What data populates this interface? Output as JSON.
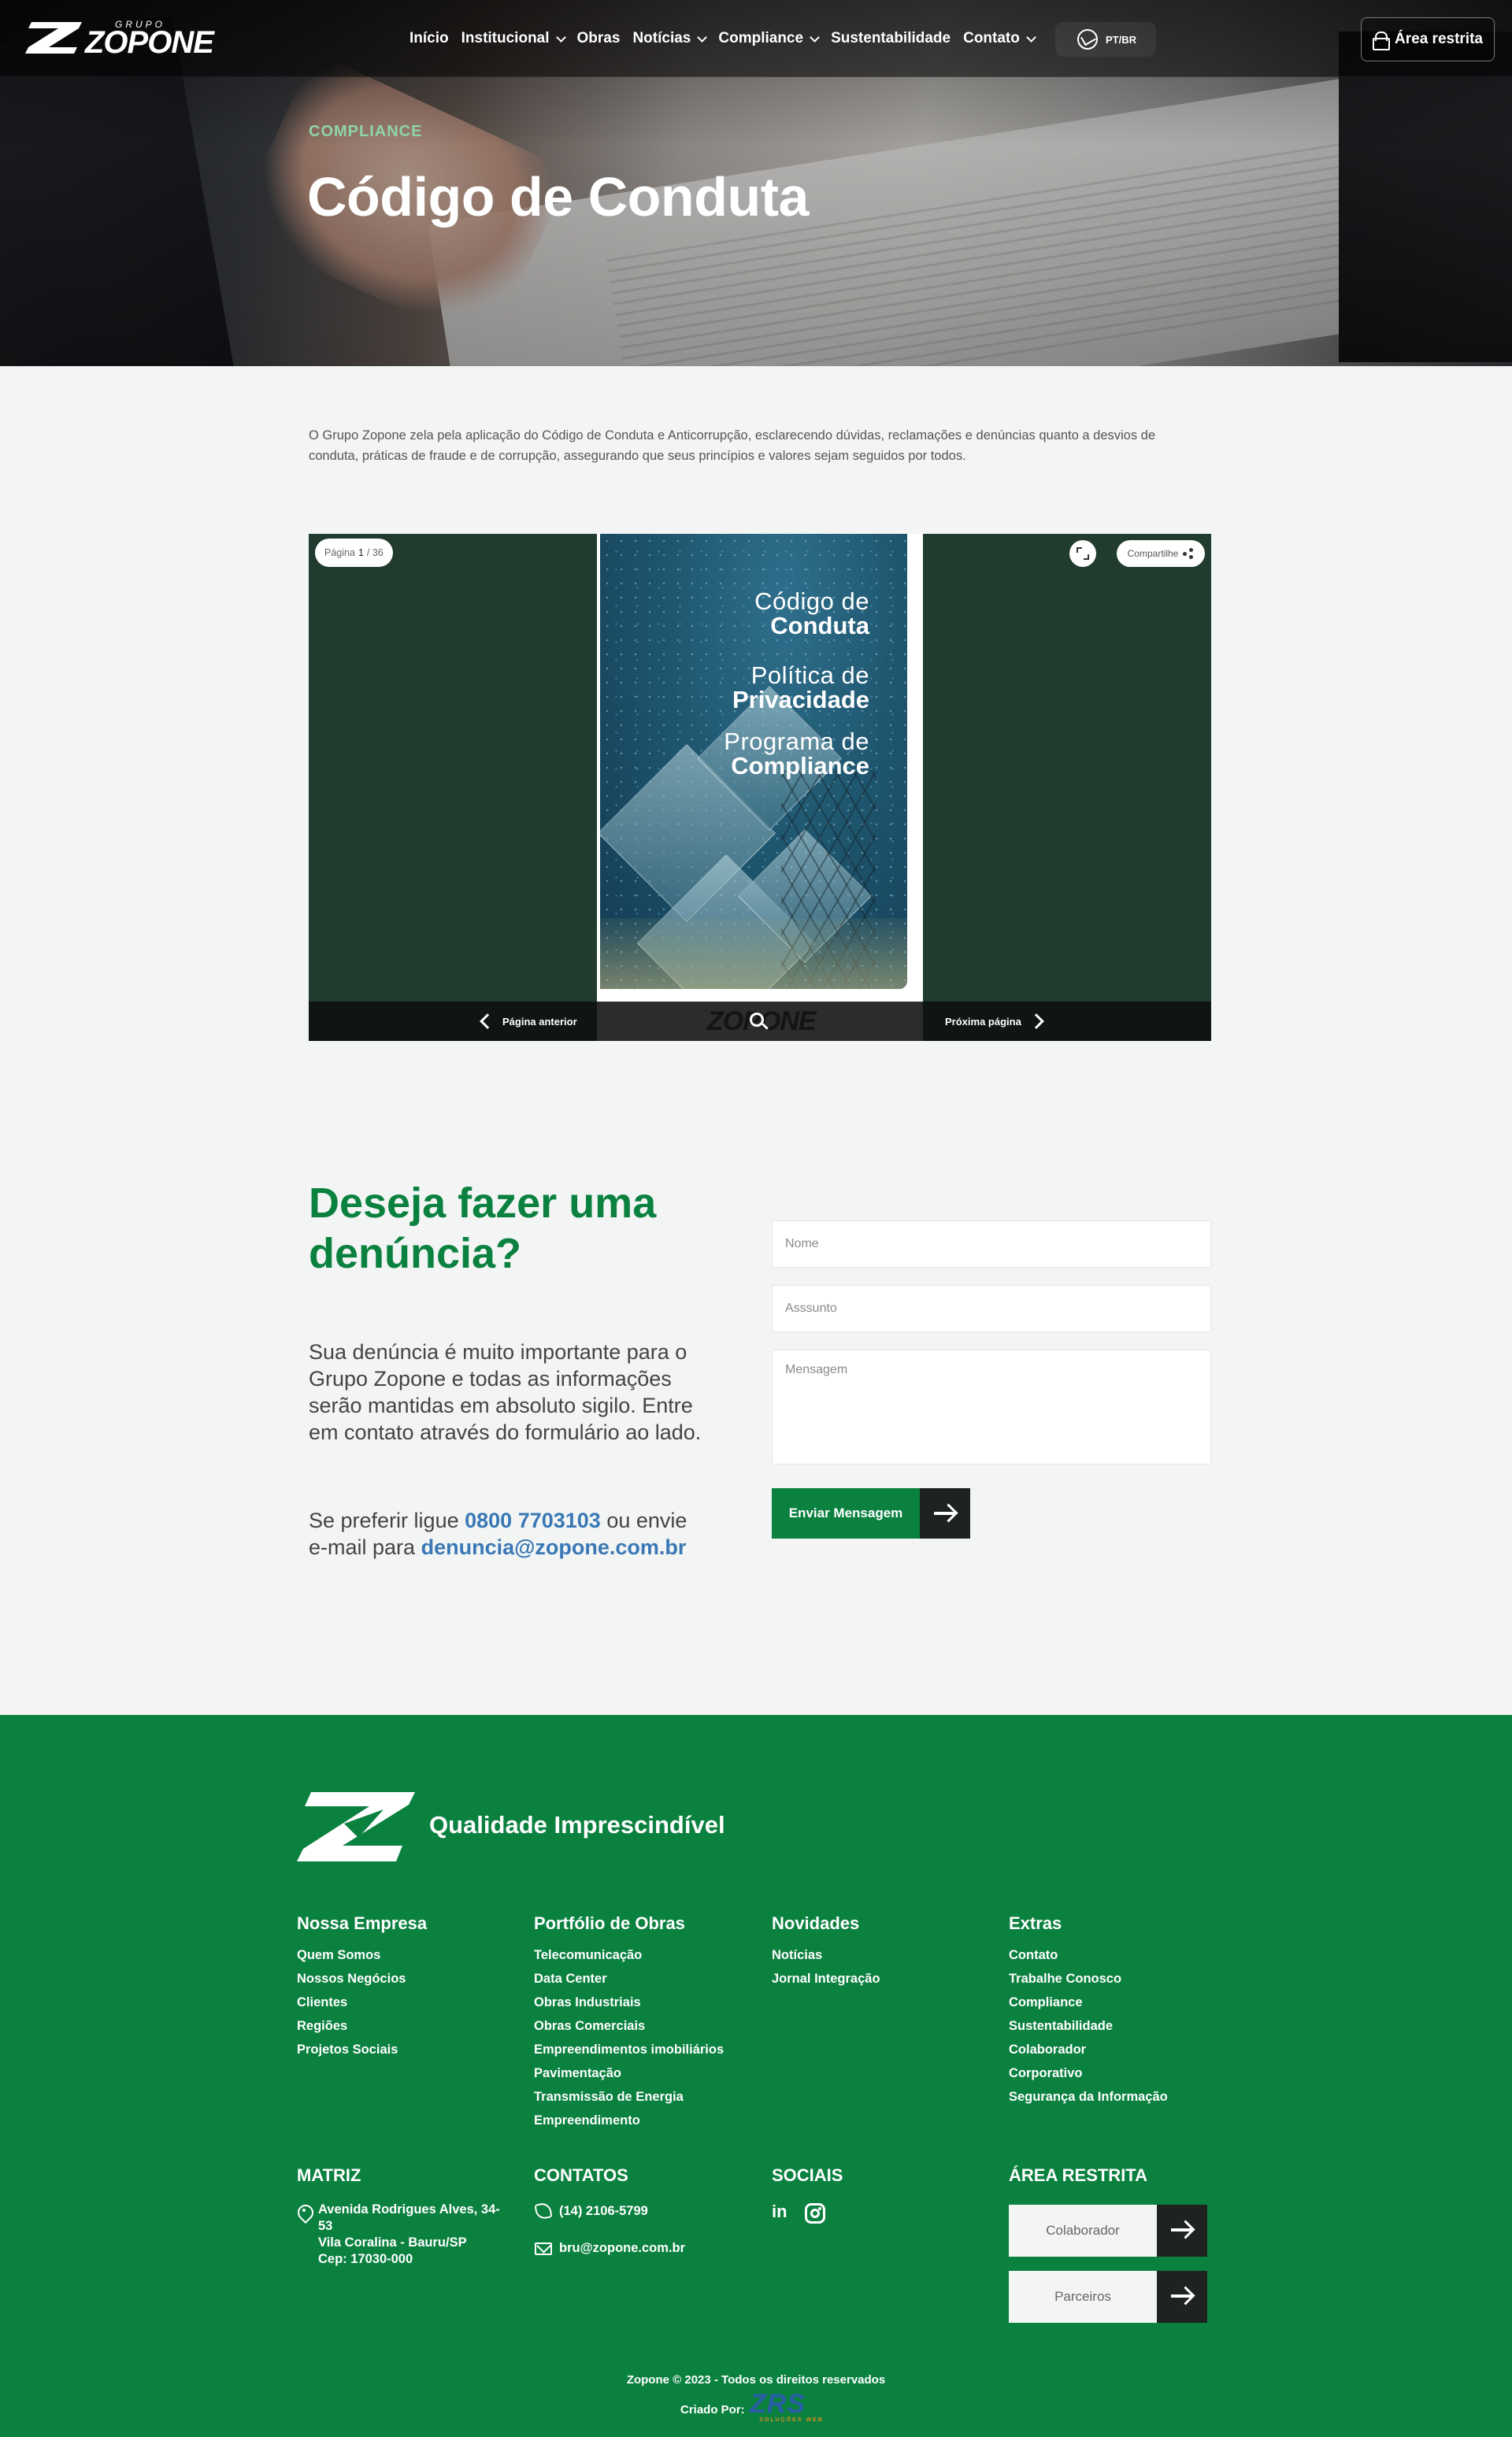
{
  "header": {
    "logo": {
      "prefix": "GRUPO",
      "name": "ZOPONE"
    },
    "nav": [
      {
        "label": "Início",
        "dropdown": false
      },
      {
        "label": "Institucional",
        "dropdown": true
      },
      {
        "label": "Obras",
        "dropdown": false
      },
      {
        "label": "Notícias",
        "dropdown": true
      },
      {
        "label": "Compliance",
        "dropdown": true
      },
      {
        "label": "Sustentabilidade",
        "dropdown": false
      },
      {
        "label": "Contato",
        "dropdown": true
      }
    ],
    "language": "PT/BR",
    "restricted_area_button": "Área restrita"
  },
  "hero": {
    "eyebrow": "COMPLIANCE",
    "title": "Código de Conduta"
  },
  "intro": "O Grupo Zopone zela pela aplicação do Código de Conduta e Anticorrupção, esclarecendo dúvidas, reclamações e denúncias quanto a desvios de conduta, práticas de fraude e de corrupção, assegurando que seus princípios e valores sejam seguidos por todos.",
  "flipbook": {
    "page_label": "Página",
    "page_current": "1",
    "page_total": "/ 36",
    "share_label": "Compartilhe",
    "prev_label": "Página anterior",
    "next_label": "Próxima página",
    "cover": [
      {
        "light": "Código de",
        "bold": "Conduta"
      },
      {
        "light": "Política de",
        "bold": "Privacidade"
      },
      {
        "light": "Programa de",
        "bold": "Compliance"
      }
    ],
    "brand_watermark": "ZOPONE"
  },
  "denuncia": {
    "title": "Deseja fazer uma denúncia?",
    "text": "Sua denúncia é muito importante para o Grupo Zopone e todas as informações serão mantidas em absoluto sigilo. Entre em contato através do formulário ao lado.",
    "contact_prefix": "Se preferir ligue",
    "phone": "0800 7703103",
    "contact_middle": "ou envie e-mail para",
    "email": "denuncia@zopone.com.br",
    "form": {
      "name_placeholder": "Nome",
      "subject_placeholder": "Asssunto",
      "message_placeholder": "Mensagem",
      "submit_label": "Enviar Mensagem"
    }
  },
  "footer": {
    "slogan": "Qualidade Imprescindível",
    "columns": [
      {
        "title": "Nossa Empresa",
        "links": [
          "Quem Somos",
          "Nossos Negócios",
          "Clientes",
          "Regiões",
          "Projetos Sociais"
        ]
      },
      {
        "title": "Portfólio de Obras",
        "links": [
          "Telecomunicação",
          "Data Center",
          "Obras Industriais",
          "Obras Comerciais",
          "Empreendimentos imobiliários",
          "Pavimentação",
          "Transmissão de Energia",
          "Empreendimento"
        ]
      },
      {
        "title": "Novidades",
        "links": [
          "Notícias",
          "Jornal Integração"
        ]
      },
      {
        "title": "Extras",
        "links": [
          "Contato",
          "Trabalhe Conosco",
          "Compliance",
          "Sustentabilidade",
          "Colaborador",
          "Corporativo",
          "Segurança da Informação"
        ]
      }
    ],
    "matriz": {
      "title": "MATRIZ",
      "address_line1": "Avenida Rodrigues Alves, 34-",
      "address_line2": "53",
      "address_line3": "Vila Coralina - Bauru/SP",
      "address_line4": "Cep: 17030-000"
    },
    "contatos": {
      "title": "CONTATOS",
      "phone": "(14) 2106-5799",
      "email": "bru@zopone.com.br"
    },
    "sociais": {
      "title": "SOCIAIS",
      "icons": [
        "linkedin-icon",
        "instagram-icon"
      ]
    },
    "area_restrita": {
      "title": "ÁREA RESTRITA",
      "buttons": [
        "Colaborador",
        "Parceiros"
      ]
    },
    "copyright": "Zopone © 2023 - Todos os direitos reservados",
    "created_by_label": "Criado Por:",
    "creator_logo": {
      "name": "ZRS",
      "sub": "SOLUÇÕES WEB"
    }
  },
  "colors": {
    "brand_green": "#0b8140",
    "dark_green": "#213b2e",
    "link_blue": "#3a78b5",
    "hero_eyebrow": "#8fd3a9"
  }
}
